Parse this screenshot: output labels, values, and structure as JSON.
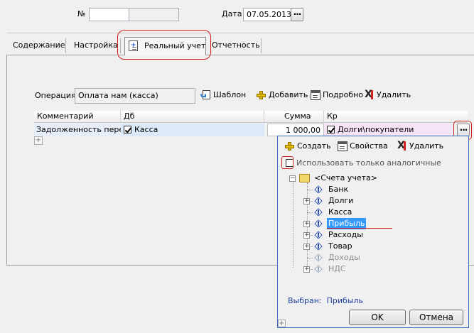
{
  "header": {
    "number_label": "№",
    "number_value": "",
    "date_label": "Дата",
    "date_value": "07.05.2013",
    "date_picker_label": "..."
  },
  "tabs": [
    {
      "label": "Содержание",
      "active": false
    },
    {
      "label": "Настройка",
      "active": false
    },
    {
      "label": "Реальный учет",
      "active": true,
      "icon": "document-icon"
    },
    {
      "label": "Отчетность",
      "active": false
    }
  ],
  "operation": {
    "label": "Операция",
    "value": "Оплата нам (касса)"
  },
  "toolbar": {
    "template_label": "Шаблон",
    "add_label": "Добавить",
    "details_label": "Подробно",
    "delete_label": "Удалить"
  },
  "grid": {
    "columns": [
      "Комментарий",
      "Дб",
      "Сумма",
      "Кр"
    ],
    "rows": [
      {
        "comment": "Задолженность перед",
        "debit": "Касса",
        "debit_checked": true,
        "amount": "1 000,00",
        "credit": "Долги\\покупатели",
        "credit_checked": true
      }
    ],
    "cell_picker_label": "..."
  },
  "picker": {
    "create_label": "Создать",
    "properties_label": "Свойства",
    "delete_label": "Удалить",
    "only_similar_label": "Использовать только аналогичные",
    "only_similar_checked": false,
    "root_label": "<Счета учета>",
    "items": [
      {
        "label": "Банк",
        "expandable": false,
        "selected": false,
        "disabled": false
      },
      {
        "label": "Долги",
        "expandable": true,
        "selected": false,
        "disabled": false
      },
      {
        "label": "Касса",
        "expandable": false,
        "selected": false,
        "disabled": false
      },
      {
        "label": "Прибыль",
        "expandable": true,
        "selected": true,
        "disabled": false
      },
      {
        "label": "Расходы",
        "expandable": true,
        "selected": false,
        "disabled": false
      },
      {
        "label": "Товар",
        "expandable": true,
        "selected": false,
        "disabled": false
      },
      {
        "label": "Доходы",
        "expandable": false,
        "selected": false,
        "disabled": true
      },
      {
        "label": "НДС",
        "expandable": true,
        "selected": false,
        "disabled": true
      }
    ],
    "selected_caption": "Выбран:",
    "selected_value": "Прибыль",
    "ok_label": "OK",
    "cancel_label": "Отмена"
  },
  "colors": {
    "selection": "#3399ff",
    "annotation": "#d01f1f",
    "dropdown_border": "#3a6fbf",
    "caption_text": "#1f3f9f",
    "row_debit": "#dce9f8",
    "row_credit": "#f6e3f6"
  }
}
